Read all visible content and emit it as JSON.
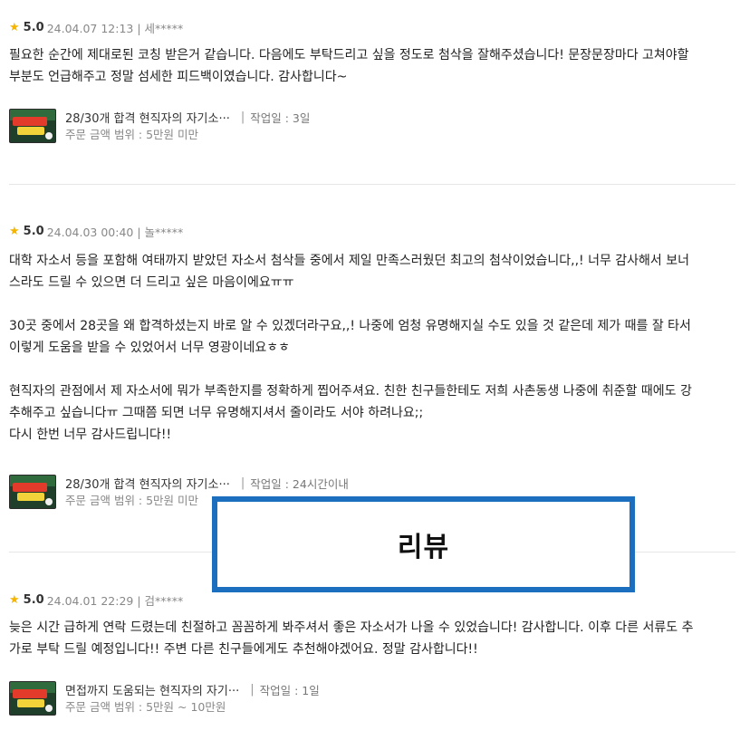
{
  "callout": {
    "label": "리뷰"
  },
  "reviews": [
    {
      "score": "5.0",
      "meta": "24.04.07 12:13 | 세*****",
      "text": "필요한 순간에 제대로된 코칭 받은거 같습니다. 다음에도 부탁드리고 싶을 정도로 첨삭을 잘해주셨습니다! 문장문장마다 고쳐야할\n부분도 언급해주고 정말 섬세한 피드백이였습니다. 감사합니다~",
      "product_title": "28/30개 합격 현직자의 자기소···",
      "work_days": "작업일 : 3일",
      "price_range": "주문 금액 범위 : 5만원 미만"
    },
    {
      "score": "5.0",
      "meta": "24.04.03 00:40 | 놀*****",
      "text": "대학 자소서 등을 포함해 여태까지 받았던 자소서 첨삭들 중에서 제일 만족스러웠던 최고의 첨삭이었습니다,,! 너무 감사해서 보너\n스라도 드릴 수 있으면 더 드리고 싶은 마음이에요ㅠㅠ\n\n30곳 중에서 28곳을 왜 합격하셨는지 바로 알 수 있겠더라구요,,! 나중에 엄청 유명해지실 수도 있을 것 같은데 제가 때를 잘 타서\n이렇게 도움을 받을 수 있었어서 너무 영광이네요ㅎㅎ\n\n현직자의 관점에서 제 자소서에 뭐가 부족한지를 정확하게 찝어주셔요. 친한 친구들한테도 저희 사촌동생 나중에 취준할 때에도 강\n추해주고 싶습니다ㅠ 그때쯤 되면 너무 유명해지셔서 줄이라도 서야 하려나요;;\n다시 한번 너무 감사드립니다!!",
      "product_title": "28/30개 합격 현직자의 자기소···",
      "work_days": "작업일 : 24시간이내",
      "price_range": "주문 금액 범위 : 5만원 미만"
    },
    {
      "score": "5.0",
      "meta": "24.04.01 22:29 | 검*****",
      "text": "늦은 시간 급하게 연락 드렸는데 친절하고 꼼꼼하게 봐주셔서 좋은 자소서가 나올 수 있었습니다! 감사합니다. 이후 다른 서류도 추\n가로 부탁 드릴 예정입니다!! 주변 다른 친구들에게도 추천해야겠어요. 정말 감사합니다!!",
      "product_title": "면접까지 도움되는 현직자의 자기···",
      "work_days": "작업일 : 1일",
      "price_range": "주문 금액 범위 : 5만원 ~ 10만원"
    }
  ]
}
